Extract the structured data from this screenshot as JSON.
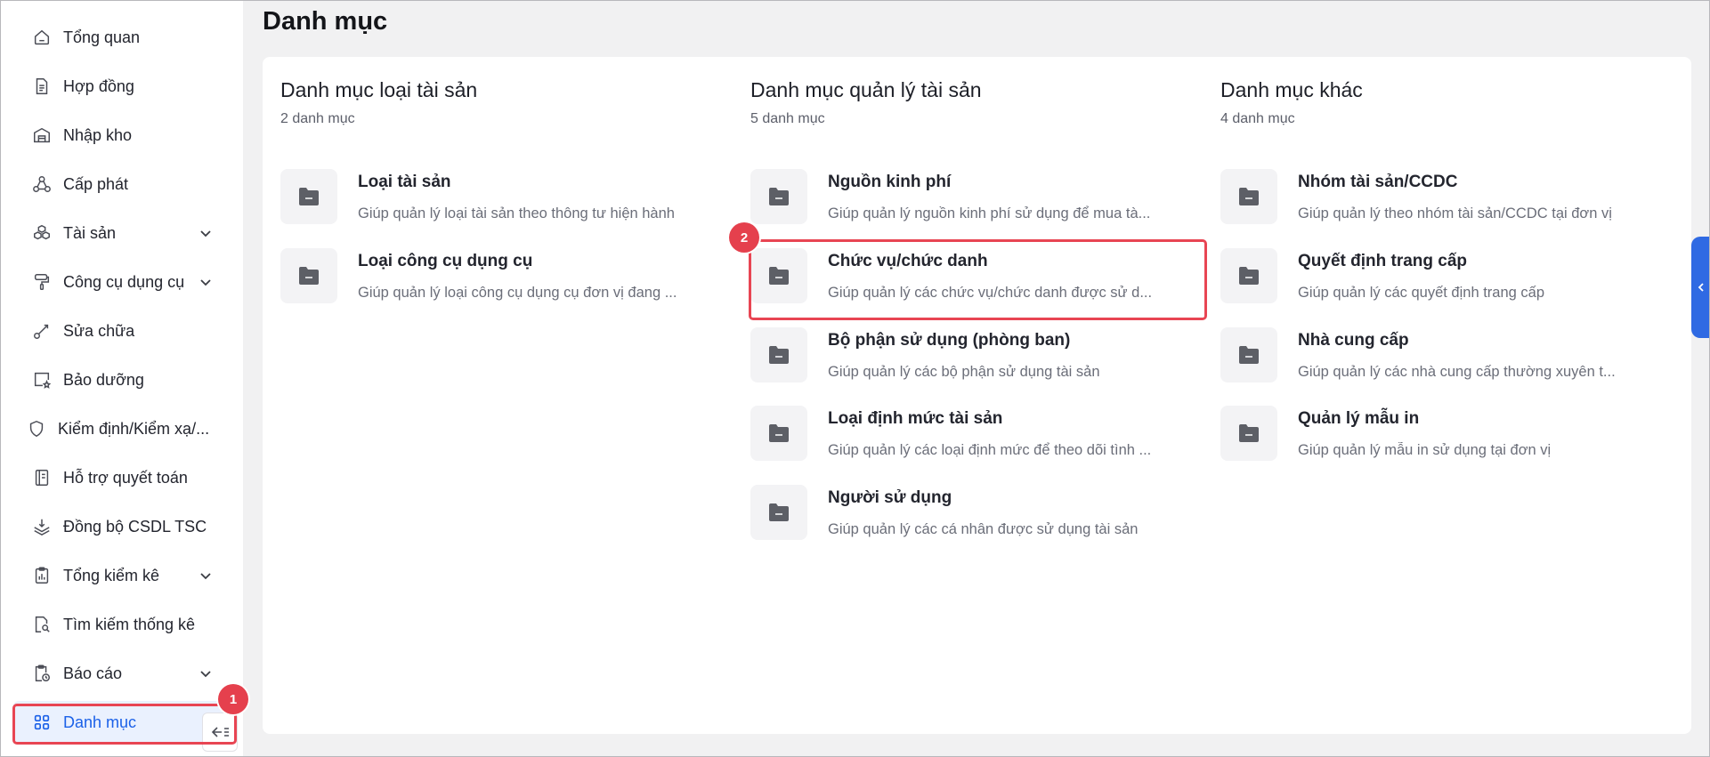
{
  "sidebar": {
    "items": [
      {
        "label": "Tổng quan",
        "icon": "home-icon",
        "has_chevron": false
      },
      {
        "label": "Hợp đồng",
        "icon": "document-icon",
        "has_chevron": false
      },
      {
        "label": "Nhập kho",
        "icon": "warehouse-icon",
        "has_chevron": false
      },
      {
        "label": "Cấp phát",
        "icon": "hierarchy-icon",
        "has_chevron": false
      },
      {
        "label": "Tài sản",
        "icon": "cubes-icon",
        "has_chevron": true
      },
      {
        "label": "Công cụ dụng cụ",
        "icon": "paint-roller-icon",
        "has_chevron": true
      },
      {
        "label": "Sửa chữa",
        "icon": "wrench-icon",
        "has_chevron": false
      },
      {
        "label": "Bảo dưỡng",
        "icon": "maintenance-icon",
        "has_chevron": false
      },
      {
        "label": "Kiểm định/Kiểm xạ/...",
        "icon": "shield-icon",
        "has_chevron": false
      },
      {
        "label": "Hỗ trợ quyết toán",
        "icon": "ledger-icon",
        "has_chevron": false
      },
      {
        "label": "Đồng bộ CSDL TSC",
        "icon": "layers-sync-icon",
        "has_chevron": false
      },
      {
        "label": "Tổng kiểm kê",
        "icon": "clipboard-chart-icon",
        "has_chevron": true
      },
      {
        "label": "Tìm kiếm thống kê",
        "icon": "file-search-icon",
        "has_chevron": false
      },
      {
        "label": "Báo cáo",
        "icon": "report-clock-icon",
        "has_chevron": true
      },
      {
        "label": "Danh mục",
        "icon": "grid-icon",
        "has_chevron": false,
        "active": true
      }
    ],
    "badge_1": "1"
  },
  "page": {
    "title": "Danh mục"
  },
  "columns": [
    {
      "title": "Danh mục loại tài sản",
      "count": "2 danh mục",
      "cards": [
        {
          "title": "Loại tài sản",
          "desc": "Giúp quản lý loại tài sản theo thông tư hiện hành"
        },
        {
          "title": "Loại công cụ dụng cụ",
          "desc": "Giúp quản lý loại công cụ dụng cụ đơn vị đang ..."
        }
      ]
    },
    {
      "title": "Danh mục quản lý tài sản",
      "count": "5 danh mục",
      "cards": [
        {
          "title": "Nguồn kinh phí",
          "desc": "Giúp quản lý nguồn kinh phí sử dụng để mua tà..."
        },
        {
          "title": "Chức vụ/chức danh",
          "desc": "Giúp quản lý các chức vụ/chức danh được sử d..."
        },
        {
          "title": "Bộ phận sử dụng (phòng ban)",
          "desc": "Giúp quản lý các bộ phận sử dụng tài sản"
        },
        {
          "title": "Loại định mức tài sản",
          "desc": "Giúp quản lý các loại định mức để theo dõi tình ..."
        },
        {
          "title": "Người sử dụng",
          "desc": "Giúp quản lý các cá nhân được sử dụng tài sản"
        }
      ]
    },
    {
      "title": "Danh mục khác",
      "count": "4 danh mục",
      "cards": [
        {
          "title": "Nhóm tài sản/CCDC",
          "desc": "Giúp quản lý theo nhóm tài sản/CCDC tại đơn vị"
        },
        {
          "title": "Quyết định trang cấp",
          "desc": "Giúp quản lý các quyết định trang cấp"
        },
        {
          "title": "Nhà cung cấp",
          "desc": "Giúp quản lý các nhà cung cấp thường xuyên t..."
        },
        {
          "title": "Quản lý mẫu in",
          "desc": "Giúp quản lý mẫu in sử dụng tại đơn vị"
        }
      ]
    }
  ],
  "annotations": {
    "badge_2": "2"
  },
  "colors": {
    "accent": "#1b61e8",
    "highlight": "#e84553",
    "side_tab": "#2f6ae3"
  }
}
